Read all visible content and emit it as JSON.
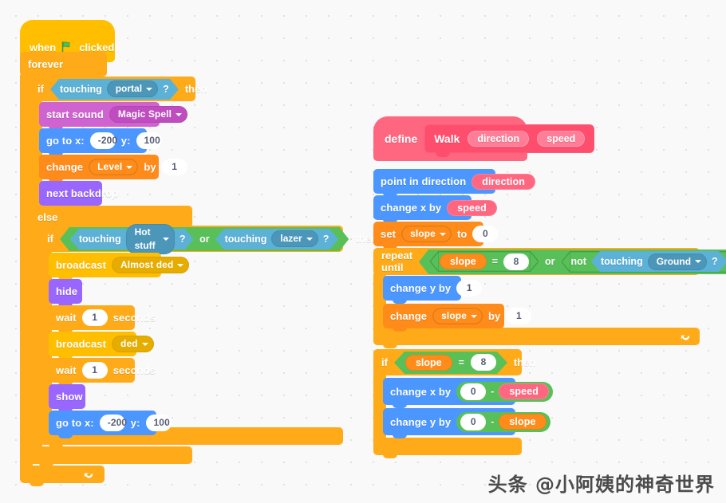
{
  "workspace": {
    "background_color": "#f9f9f9",
    "grid_dot_color": "#e0e0e0"
  },
  "watermark": "头条 @小阿姨的神奇世界",
  "palette": {
    "events": "#ffbf00",
    "control": "#ffab19",
    "motion": "#4c97ff",
    "looks": "#9966ff",
    "sound": "#cf63cf",
    "sensing": "#5cb1d6",
    "operators": "#59c059",
    "variables": "#ff8c1a",
    "custom": "#ff6680"
  },
  "script_main": {
    "hat": {
      "when": "when",
      "flag_icon": "green-flag-icon",
      "clicked": "clicked"
    },
    "forever": "forever",
    "if1": {
      "if": "if",
      "then": "then",
      "condition": {
        "touching": "touching",
        "target": "portal",
        "question": "?"
      }
    },
    "start_sound": {
      "label": "start sound",
      "value": "Magic Spell"
    },
    "go_to_1": {
      "label": "go to x:",
      "x": "-200",
      "ylabel": "y:",
      "y": "100"
    },
    "change_level": {
      "label": "change",
      "variable": "Level",
      "by": "by",
      "value": "1"
    },
    "next_backdrop": "next backdrop",
    "else": "else",
    "if2": {
      "if": "if",
      "then": "then",
      "or": "or",
      "cond_a": {
        "touching": "touching",
        "target": "Hot stuff",
        "question": "?"
      },
      "cond_b": {
        "touching": "touching",
        "target": "lazer",
        "question": "?"
      }
    },
    "broadcast_1": {
      "label": "broadcast",
      "value": "Almost ded"
    },
    "hide": "hide",
    "wait_1": {
      "label": "wait",
      "value": "1",
      "unit": "seconds"
    },
    "broadcast_2": {
      "label": "broadcast",
      "value": "ded"
    },
    "wait_2": {
      "label": "wait",
      "value": "1",
      "unit": "seconds"
    },
    "show": "show",
    "go_to_2": {
      "label": "go to x:",
      "x": "-200",
      "ylabel": "y:",
      "y": "100"
    }
  },
  "script_define": {
    "define": {
      "label": "define",
      "name": "Walk",
      "params": [
        "direction",
        "speed"
      ]
    },
    "point_in_direction": {
      "label": "point in direction",
      "value": "direction"
    },
    "change_x_by_speed": {
      "label": "change x by",
      "value": "speed"
    },
    "set_slope": {
      "label": "set",
      "variable": "slope",
      "to": "to",
      "value": "0"
    },
    "repeat_until": {
      "label": "repeat until",
      "or": "or",
      "not": "not",
      "cond_a": {
        "left": "slope",
        "op": "=",
        "right": "8"
      },
      "cond_b": {
        "touching": "touching",
        "target": "Ground",
        "question": "?"
      }
    },
    "change_y_by_1": {
      "label": "change y by",
      "value": "1"
    },
    "change_slope_by_1": {
      "label": "change",
      "variable": "slope",
      "by": "by",
      "value": "1"
    },
    "if3": {
      "if": "if",
      "then": "then",
      "condition": {
        "left": "slope",
        "op": "=",
        "right": "8"
      }
    },
    "change_x_by_sub": {
      "label": "change x by",
      "left": "0",
      "op": "-",
      "right": "speed"
    },
    "change_y_by_sub": {
      "label": "change y by",
      "left": "0",
      "op": "-",
      "right": "slope"
    }
  }
}
